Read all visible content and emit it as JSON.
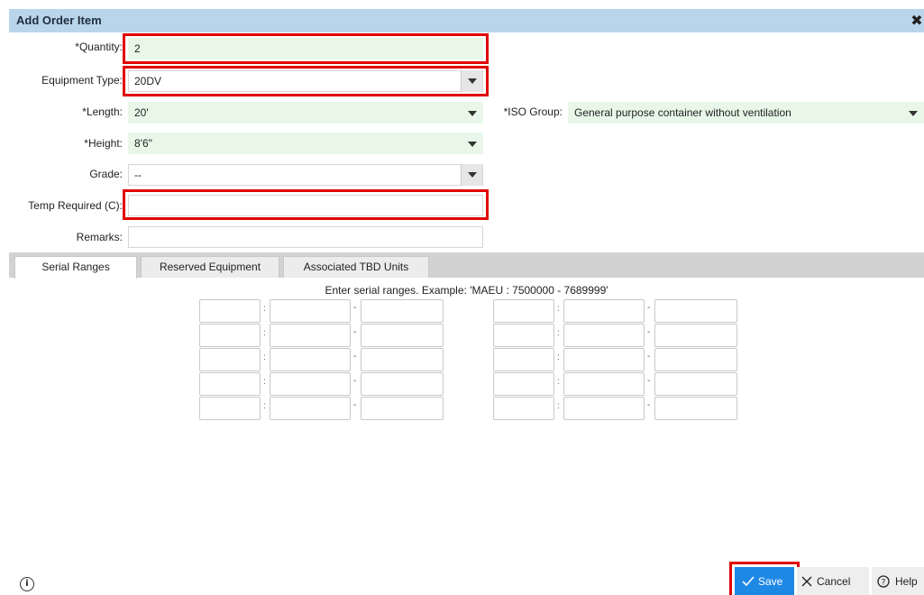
{
  "dialog": {
    "title": "Add Order Item"
  },
  "form": {
    "quantity": {
      "label": "*Quantity:",
      "value": "2"
    },
    "equipment_type": {
      "label": "Equipment Type:",
      "value": "20DV"
    },
    "length": {
      "label": "*Length:",
      "value": "20'"
    },
    "iso_group": {
      "label": "*ISO Group:",
      "value": "General purpose container without ventilation"
    },
    "height": {
      "label": "*Height:",
      "value": "8'6\""
    },
    "grade": {
      "label": "Grade:",
      "value": "--"
    },
    "temp_required": {
      "label": "Temp Required (C):",
      "value": ""
    },
    "remarks": {
      "label": "Remarks:",
      "value": ""
    }
  },
  "tabs": [
    {
      "label": "Serial Ranges",
      "active": true
    },
    {
      "label": "Reserved Equipment",
      "active": false
    },
    {
      "label": "Associated TBD Units",
      "active": false
    }
  ],
  "serial_ranges": {
    "help_text": "Enter serial ranges. Example: 'MAEU : 7500000 - 7689999'",
    "separator_colon": ":",
    "separator_dash": "-"
  },
  "footer": {
    "save_label": "Save",
    "cancel_label": "Cancel",
    "help_label": "Help"
  },
  "colors": {
    "titlebar": "#b9d5ec",
    "required_field_bg": "#e8f7e8",
    "primary_button": "#1e88e5",
    "highlight": "#e00000"
  }
}
